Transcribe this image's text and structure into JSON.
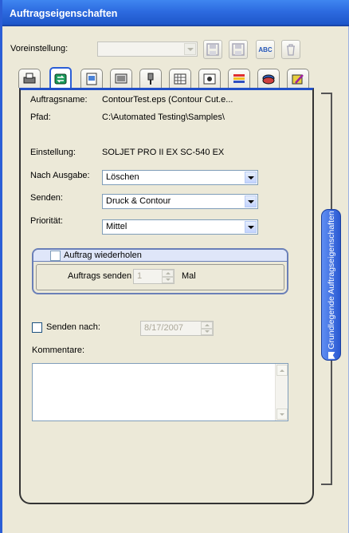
{
  "window": {
    "title": "Auftragseigenschaften"
  },
  "preset": {
    "label": "Voreinstellung:",
    "value": "",
    "buttons": [
      {
        "name": "save-preset",
        "icon": "floppy-disk-icon"
      },
      {
        "name": "save-as-preset",
        "icon": "floppy-disk-arrow-icon"
      },
      {
        "name": "rename-preset",
        "icon": "abc-icon",
        "text": "ABC"
      },
      {
        "name": "delete-preset",
        "icon": "trash-icon"
      }
    ]
  },
  "tabs": [
    {
      "name": "tab-general",
      "icon": "printer-icon",
      "active": false
    },
    {
      "name": "tab-job",
      "icon": "job-arrows-icon",
      "active": true
    },
    {
      "name": "tab-image",
      "icon": "image-icon",
      "active": false
    },
    {
      "name": "tab-media",
      "icon": "media-icon",
      "active": false
    },
    {
      "name": "tab-cutter",
      "icon": "cutter-icon",
      "active": false
    },
    {
      "name": "tab-grid",
      "icon": "grid-icon",
      "active": false
    },
    {
      "name": "tab-marks",
      "icon": "marks-icon",
      "active": false
    },
    {
      "name": "tab-color",
      "icon": "color-bars-icon",
      "active": false
    },
    {
      "name": "tab-profile",
      "icon": "profile-icon",
      "active": false
    },
    {
      "name": "tab-color-edit",
      "icon": "color-pencil-icon",
      "active": false
    }
  ],
  "job": {
    "name_label": "Auftragsname:",
    "name_value": "ContourTest.eps (Contour Cut.e...",
    "path_label": "Pfad:",
    "path_value": "C:\\Automated Testing\\Samples\\",
    "setting_label": "Einstellung:",
    "setting_value": "SOLJET PRO II EX SC-540 EX",
    "after_output_label": "Nach Ausgabe:",
    "after_output_value": "Löschen",
    "send_label": "Senden:",
    "send_value": "Druck & Contour",
    "priority_label": "Priorität:",
    "priority_value": "Mittel",
    "repeat_label": "Auftrag wiederholen",
    "repeat_checked": false,
    "send_count_label": "Auftrags senden",
    "send_count_value": "1",
    "send_count_unit": "Mal",
    "send_after_label": "Senden nach:",
    "send_after_checked": false,
    "send_after_date": "8/17/2007",
    "comments_label": "Kommentare:",
    "comments_value": ""
  },
  "side_tab": {
    "label": "Grundlegende Auftragseigenschaften",
    "icon": "bookmark-icon"
  },
  "colors": {
    "title_bar": "#2d6be0",
    "accent": "#2250c8",
    "face": "#ece9d8"
  }
}
